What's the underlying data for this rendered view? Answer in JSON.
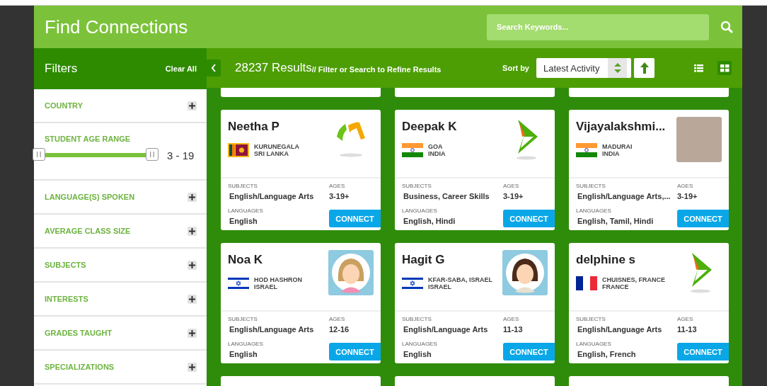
{
  "header": {
    "title": "Find Connections",
    "search": {
      "placeholder": "Search Keywords..."
    }
  },
  "filters": {
    "title": "Filters",
    "clear_all": "Clear All",
    "sections": [
      {
        "kind": "collapsible",
        "label": "COUNTRY",
        "expanded": false
      },
      {
        "kind": "range",
        "label": "STUDENT AGE RANGE",
        "reading": "3 - 19",
        "handles": [
          {
            "level": 0
          },
          {
            "level": 1
          }
        ]
      },
      {
        "kind": "collapsible",
        "label": "LANGUAGE(S) SPOKEN",
        "expanded": false
      },
      {
        "kind": "collapsible",
        "label": "AVERAGE CLASS SIZE",
        "expanded": false
      },
      {
        "kind": "collapsible",
        "label": "SUBJECTS",
        "expanded": false
      },
      {
        "kind": "collapsible",
        "label": "INTERESTS",
        "expanded": false
      },
      {
        "kind": "collapsible",
        "label": "GRADES TAUGHT",
        "expanded": false
      },
      {
        "kind": "collapsible",
        "label": "SPECIALIZATIONS",
        "expanded": false
      }
    ]
  },
  "results": {
    "count": "28237 Results",
    "hint": "// Filter or Search to Refine Results",
    "sort": {
      "label": "Sort by",
      "value": "Latest Activity"
    },
    "views": [
      {
        "kind": "list",
        "selected": false
      },
      {
        "kind": "grid",
        "selected": true
      }
    ]
  },
  "cards": [
    {
      "name": "Neetha P",
      "flag": {
        "kind": "sri-lanka"
      },
      "city": "KURUNEGALA",
      "country": "SRI LANKA",
      "picture": {
        "kind": "logo-arch"
      },
      "subjects_label": "SUBJECTS",
      "subjects": "English/Language Arts",
      "ages_label": "AGES",
      "ages": "3-19+",
      "languages_label": "LANGUAGES",
      "languages": "English",
      "button": "CONNECT"
    },
    {
      "name": "Deepak K",
      "flag": {
        "kind": "india"
      },
      "city": "GOA",
      "country": "INDIA",
      "picture": {
        "kind": "logo-triangle"
      },
      "subjects_label": "SUBJECTS",
      "subjects": "Business, Career Skills",
      "ages_label": "AGES",
      "ages": "3-19+",
      "languages_label": "LANGUAGES",
      "languages": "English, Hindi",
      "button": "CONNECT"
    },
    {
      "name": "Vijayalakshmi...",
      "flag": {
        "kind": "india"
      },
      "city": "MADURAI",
      "country": "INDIA",
      "picture": {
        "kind": "photo"
      },
      "subjects_label": "SUBJECTS",
      "subjects": "English/Language Arts,...",
      "ages_label": "AGES",
      "ages": "3-19+",
      "languages_label": "LANGUAGES",
      "languages": "English, Tamil, Hindi",
      "button": "CONNECT"
    },
    {
      "name": "Noa K",
      "flag": {
        "kind": "israel"
      },
      "city": "HOD HASHRON",
      "country": "ISRAEL",
      "picture": {
        "kind": "avatar-light-hair"
      },
      "subjects_label": "SUBJECTS",
      "subjects": "English/Language Arts",
      "ages_label": "AGES",
      "ages": "12-16",
      "languages_label": "LANGUAGES",
      "languages": "English",
      "button": "CONNECT"
    },
    {
      "name": "Hagit G",
      "flag": {
        "kind": "israel"
      },
      "city": "KFAR-SABA, ISRAEL",
      "country": "ISRAEL",
      "picture": {
        "kind": "avatar-dark-hair"
      },
      "subjects_label": "SUBJECTS",
      "subjects": "English/Language Arts",
      "ages_label": "AGES",
      "ages": "11-13",
      "languages_label": "LANGUAGES",
      "languages": "English",
      "button": "CONNECT"
    },
    {
      "name": "delphine s",
      "flag": {
        "kind": "france"
      },
      "city": "CHUISNES, FRANCE",
      "country": "FRANCE",
      "picture": {
        "kind": "logo-triangle"
      },
      "subjects_label": "SUBJECTS",
      "subjects": "English/Language Arts",
      "ages_label": "AGES",
      "ages": "11-13",
      "languages_label": "LANGUAGES",
      "languages": "English, French",
      "button": "CONNECT"
    }
  ]
}
